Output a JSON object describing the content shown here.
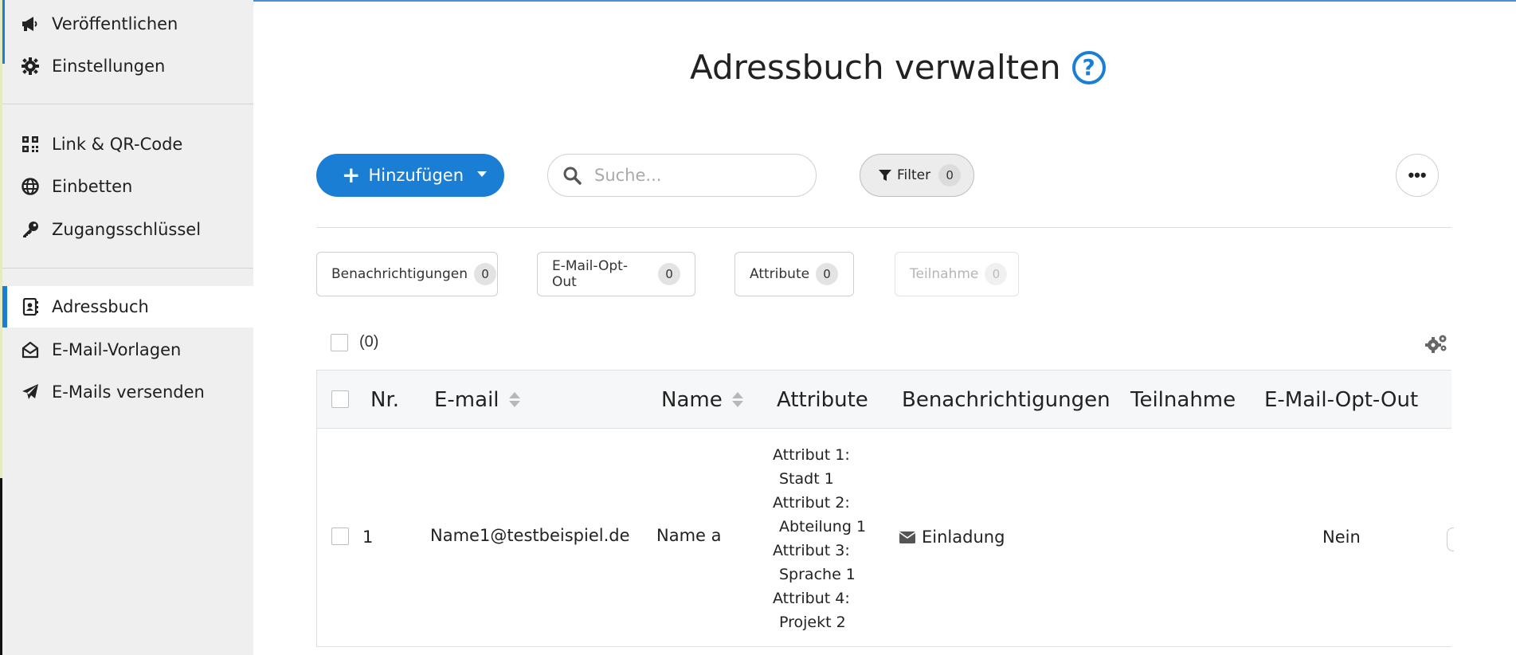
{
  "sidebar": {
    "items": [
      {
        "label": "Veröffentlichen",
        "icon": "megaphone-icon"
      },
      {
        "label": "Einstellungen",
        "icon": "gear-icon"
      },
      {
        "label": "Link & QR-Code",
        "icon": "qr-code-icon"
      },
      {
        "label": "Einbetten",
        "icon": "globe-icon"
      },
      {
        "label": "Zugangsschlüssel",
        "icon": "key-icon"
      },
      {
        "label": "Adressbuch",
        "icon": "address-book-icon",
        "active": true
      },
      {
        "label": "E-Mail-Vorlagen",
        "icon": "envelope-open-icon"
      },
      {
        "label": "E-Mails versenden",
        "icon": "paper-plane-icon"
      }
    ]
  },
  "header": {
    "title": "Adressbuch verwalten",
    "help_icon": "question-circle-icon"
  },
  "toolbar": {
    "add_label": "Hinzufügen",
    "search_placeholder": "Suche...",
    "filter_label": "Filter",
    "filter_count": "0",
    "more_label": "•••"
  },
  "chips": [
    {
      "label": "Benachrichtigungen",
      "count": "0"
    },
    {
      "label": "E-Mail-Opt-Out",
      "count": "0"
    },
    {
      "label": "Attribute",
      "count": "0"
    },
    {
      "label": "Teilnahme",
      "count": "0",
      "disabled": true
    }
  ],
  "selection": {
    "count_label": "(0)"
  },
  "table": {
    "columns": [
      "Nr.",
      "E-mail",
      "Name",
      "Attribute",
      "Benachrichtigungen",
      "Teilnahme",
      "E-Mail-Opt-Out"
    ],
    "rows": [
      {
        "nr": "1",
        "email": "Name1@testbeispiel.de",
        "name": "Name a",
        "attributes": [
          {
            "key": "Attribut 1:",
            "value": "Stadt 1"
          },
          {
            "key": "Attribut 2:",
            "value": "Abteilung 1"
          },
          {
            "key": "Attribut 3:",
            "value": "Sprache 1"
          },
          {
            "key": "Attribut 4:",
            "value": "Projekt 2"
          }
        ],
        "notification": "Einladung",
        "participation": "",
        "opt_out": "Nein"
      }
    ]
  },
  "colors": {
    "accent": "#1a7fd4",
    "sidebar_bg": "#efefef"
  }
}
